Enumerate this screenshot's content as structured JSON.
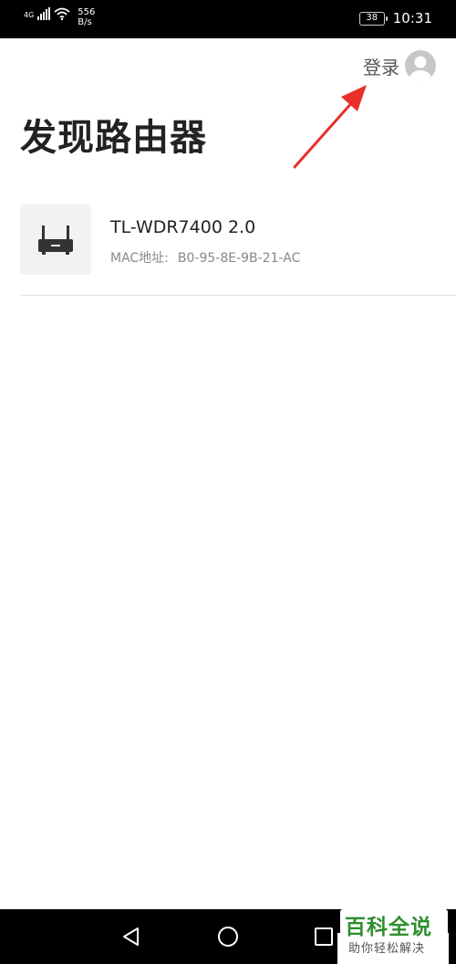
{
  "status_bar": {
    "network": "4G",
    "speed_value": "556",
    "speed_unit": "B/s",
    "battery": "38",
    "time": "10:31"
  },
  "header": {
    "login_label": "登录",
    "title": "发现路由器"
  },
  "devices": [
    {
      "name": "TL-WDR7400 2.0",
      "mac_label": "MAC地址:",
      "mac_value": "B0-95-8E-9B-21-AC"
    }
  ],
  "icons": {
    "avatar": "user-avatar-icon",
    "router": "router-icon",
    "back": "back-triangle-icon",
    "home": "home-circle-icon",
    "recents": "recents-square-icon"
  },
  "watermark": {
    "title": "百科全说",
    "subtitle": "助你轻松解决"
  },
  "colors": {
    "arrow": "#e8302a",
    "watermark_green": "#2f8f2f"
  }
}
